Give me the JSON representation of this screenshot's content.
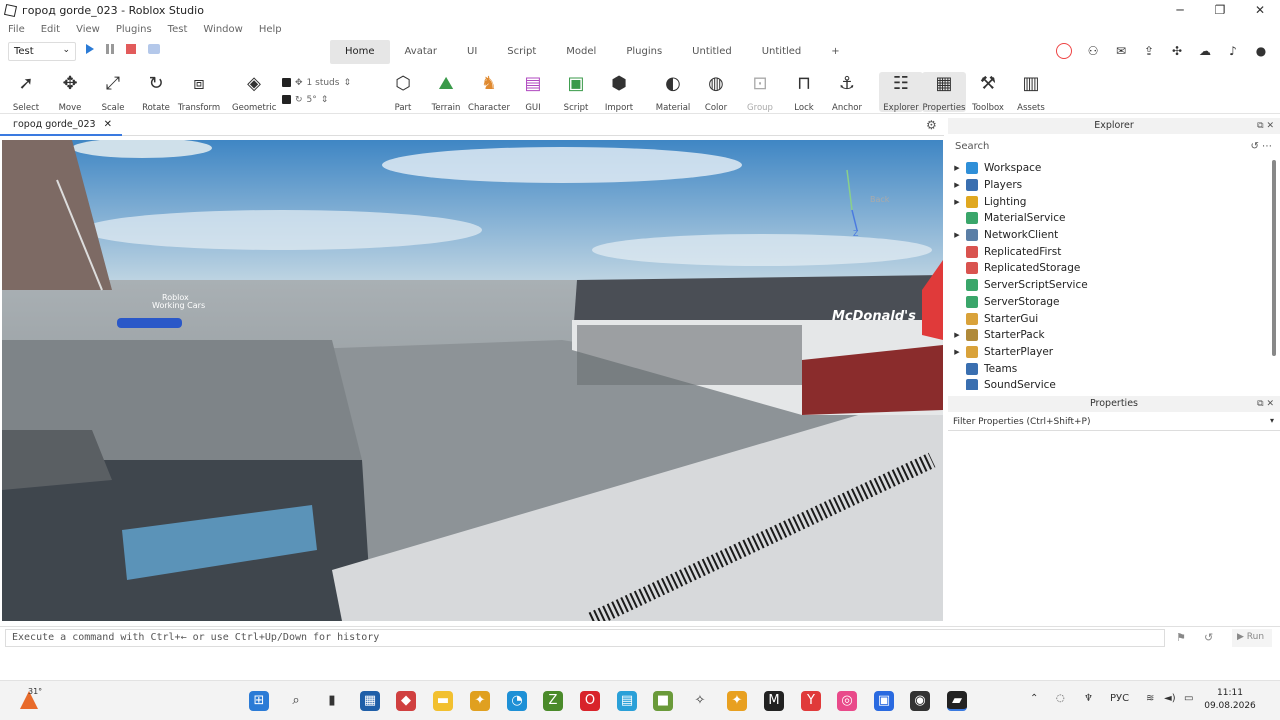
{
  "window": {
    "title": "город gorde_023 - Roblox Studio",
    "controls": [
      "─",
      "❐",
      "✕"
    ]
  },
  "menu": [
    "File",
    "Edit",
    "View",
    "Plugins",
    "Test",
    "Window",
    "Help"
  ],
  "test_selector": "Test",
  "tabs": [
    "Home",
    "Avatar",
    "UI",
    "Script",
    "Model",
    "Plugins",
    "Untitled",
    "Untitled",
    "+"
  ],
  "active_tab": "Home",
  "ribbon": {
    "select": "Select",
    "move": "Move",
    "scale": "Scale",
    "rotate": "Rotate",
    "transform": "Transform",
    "geometric": "Geometric",
    "studs": "1 studs",
    "degrees": "5°",
    "part": "Part",
    "terrain": "Terrain",
    "character": "Character",
    "gui": "GUI",
    "script": "Script",
    "import": "Import",
    "material": "Material",
    "color": "Color",
    "group": "Group",
    "lock": "Lock",
    "anchor": "Anchor",
    "explorer": "Explorer",
    "properties": "Properties",
    "toolbox": "Toolbox",
    "assets": "Assets"
  },
  "file_tab": {
    "name": "город gorde_023",
    "close": "✕"
  },
  "viewport": {
    "billboard": "Roblox\nWorking Cars",
    "restaurant_sign": "McDonald's",
    "gizmo_label": "Back",
    "gizmo_axis": "Z"
  },
  "explorer": {
    "title": "Explorer",
    "search_placeholder": "Search",
    "items": [
      {
        "label": "Workspace",
        "expandable": true,
        "color": "#2f8fd8"
      },
      {
        "label": "Players",
        "expandable": true,
        "color": "#3a6fb0"
      },
      {
        "label": "Lighting",
        "expandable": true,
        "color": "#e0a820"
      },
      {
        "label": "MaterialService",
        "expandable": false,
        "color": "#3aa66a"
      },
      {
        "label": "NetworkClient",
        "expandable": true,
        "color": "#5b7fa6"
      },
      {
        "label": "ReplicatedFirst",
        "expandable": false,
        "color": "#d9534f"
      },
      {
        "label": "ReplicatedStorage",
        "expandable": false,
        "color": "#d9534f"
      },
      {
        "label": "ServerScriptService",
        "expandable": false,
        "color": "#3aa66a"
      },
      {
        "label": "ServerStorage",
        "expandable": false,
        "color": "#3aa66a"
      },
      {
        "label": "StarterGui",
        "expandable": false,
        "color": "#d9a23a"
      },
      {
        "label": "StarterPack",
        "expandable": true,
        "color": "#b08a3a"
      },
      {
        "label": "StarterPlayer",
        "expandable": true,
        "color": "#d9a23a"
      },
      {
        "label": "Teams",
        "expandable": false,
        "color": "#3a6fb0"
      },
      {
        "label": "SoundService",
        "expandable": false,
        "color": "#3a6fb0"
      }
    ]
  },
  "properties": {
    "title": "Properties",
    "filter_placeholder": "Filter Properties (Ctrl+Shift+P)"
  },
  "command_bar": {
    "placeholder": "Execute a command with Ctrl+← or use Ctrl+Up/Down for history",
    "run": "Run"
  },
  "taskbar": {
    "weather_temp": "31°",
    "lang": "РУС",
    "time": "11:11",
    "date": "09.08.2026"
  }
}
